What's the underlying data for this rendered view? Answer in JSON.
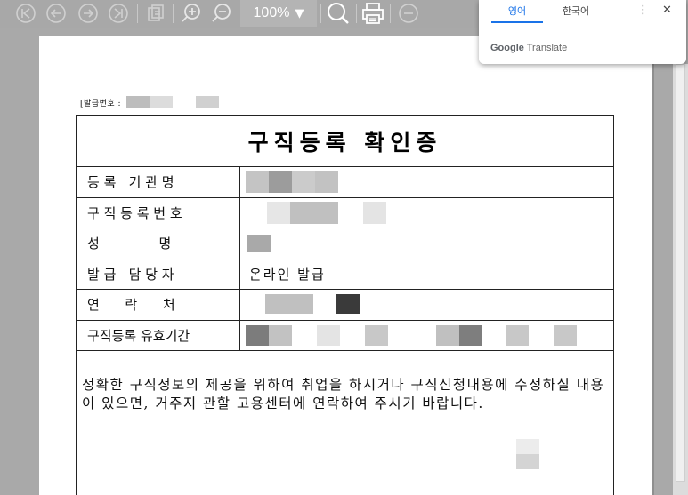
{
  "toolbar": {
    "zoom": "100%",
    "icons": [
      "first-page-icon",
      "previous-page-icon",
      "next-page-icon",
      "last-page-icon",
      "fit-page-icon",
      "zoom-in-icon",
      "zoom-out-icon",
      "search-icon",
      "print-icon",
      "minus-circle-icon"
    ]
  },
  "document": {
    "issue_label": "[발급번호 :",
    "title": "구직등록 확인증",
    "rows": [
      {
        "label": "등 록   기 관 명",
        "value": ""
      },
      {
        "label": "구 직 등 록 번 호",
        "value": ""
      },
      {
        "label": "성              명",
        "value": ""
      },
      {
        "label": "발 급   담 당 자",
        "value": "온라인 발급"
      },
      {
        "label": "연      락      처",
        "value": ""
      },
      {
        "label": "구직등록 유효기간",
        "value": ""
      }
    ],
    "notice": "정확한 구직정보의 제공을 위하여 취업을 하시거나 구직신청내용에 수정하실 내용이 있으면, 거주지 관할 고용센터에 연락하여 주시기 바랍니다."
  },
  "translate_popup": {
    "tab_source": "영어",
    "tab_target": "한국어",
    "more_label": "⋮",
    "close_label": "✕",
    "footer_brand": "Google",
    "footer_product": "Translate"
  },
  "colors": {
    "accent": "#1a73e8",
    "toolbar_bg": "#a8a8a8",
    "viewer_bg": "#a9a9a9"
  }
}
